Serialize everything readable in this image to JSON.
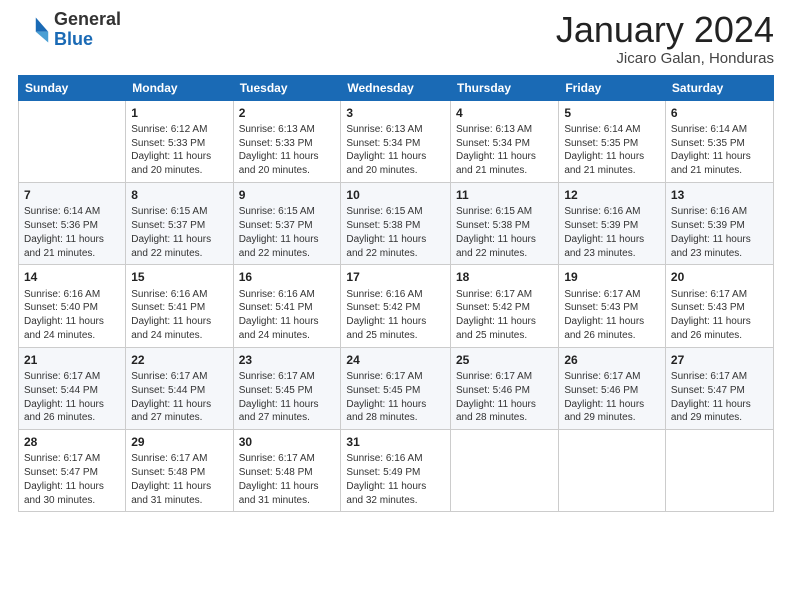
{
  "header": {
    "logo_general": "General",
    "logo_blue": "Blue",
    "month_title": "January 2024",
    "subtitle": "Jicaro Galan, Honduras"
  },
  "days_of_week": [
    "Sunday",
    "Monday",
    "Tuesday",
    "Wednesday",
    "Thursday",
    "Friday",
    "Saturday"
  ],
  "weeks": [
    [
      {
        "day": "",
        "text": ""
      },
      {
        "day": "1",
        "text": "Sunrise: 6:12 AM\nSunset: 5:33 PM\nDaylight: 11 hours\nand 20 minutes."
      },
      {
        "day": "2",
        "text": "Sunrise: 6:13 AM\nSunset: 5:33 PM\nDaylight: 11 hours\nand 20 minutes."
      },
      {
        "day": "3",
        "text": "Sunrise: 6:13 AM\nSunset: 5:34 PM\nDaylight: 11 hours\nand 20 minutes."
      },
      {
        "day": "4",
        "text": "Sunrise: 6:13 AM\nSunset: 5:34 PM\nDaylight: 11 hours\nand 21 minutes."
      },
      {
        "day": "5",
        "text": "Sunrise: 6:14 AM\nSunset: 5:35 PM\nDaylight: 11 hours\nand 21 minutes."
      },
      {
        "day": "6",
        "text": "Sunrise: 6:14 AM\nSunset: 5:35 PM\nDaylight: 11 hours\nand 21 minutes."
      }
    ],
    [
      {
        "day": "7",
        "text": "Sunrise: 6:14 AM\nSunset: 5:36 PM\nDaylight: 11 hours\nand 21 minutes."
      },
      {
        "day": "8",
        "text": "Sunrise: 6:15 AM\nSunset: 5:37 PM\nDaylight: 11 hours\nand 22 minutes."
      },
      {
        "day": "9",
        "text": "Sunrise: 6:15 AM\nSunset: 5:37 PM\nDaylight: 11 hours\nand 22 minutes."
      },
      {
        "day": "10",
        "text": "Sunrise: 6:15 AM\nSunset: 5:38 PM\nDaylight: 11 hours\nand 22 minutes."
      },
      {
        "day": "11",
        "text": "Sunrise: 6:15 AM\nSunset: 5:38 PM\nDaylight: 11 hours\nand 22 minutes."
      },
      {
        "day": "12",
        "text": "Sunrise: 6:16 AM\nSunset: 5:39 PM\nDaylight: 11 hours\nand 23 minutes."
      },
      {
        "day": "13",
        "text": "Sunrise: 6:16 AM\nSunset: 5:39 PM\nDaylight: 11 hours\nand 23 minutes."
      }
    ],
    [
      {
        "day": "14",
        "text": "Sunrise: 6:16 AM\nSunset: 5:40 PM\nDaylight: 11 hours\nand 24 minutes."
      },
      {
        "day": "15",
        "text": "Sunrise: 6:16 AM\nSunset: 5:41 PM\nDaylight: 11 hours\nand 24 minutes."
      },
      {
        "day": "16",
        "text": "Sunrise: 6:16 AM\nSunset: 5:41 PM\nDaylight: 11 hours\nand 24 minutes."
      },
      {
        "day": "17",
        "text": "Sunrise: 6:16 AM\nSunset: 5:42 PM\nDaylight: 11 hours\nand 25 minutes."
      },
      {
        "day": "18",
        "text": "Sunrise: 6:17 AM\nSunset: 5:42 PM\nDaylight: 11 hours\nand 25 minutes."
      },
      {
        "day": "19",
        "text": "Sunrise: 6:17 AM\nSunset: 5:43 PM\nDaylight: 11 hours\nand 26 minutes."
      },
      {
        "day": "20",
        "text": "Sunrise: 6:17 AM\nSunset: 5:43 PM\nDaylight: 11 hours\nand 26 minutes."
      }
    ],
    [
      {
        "day": "21",
        "text": "Sunrise: 6:17 AM\nSunset: 5:44 PM\nDaylight: 11 hours\nand 26 minutes."
      },
      {
        "day": "22",
        "text": "Sunrise: 6:17 AM\nSunset: 5:44 PM\nDaylight: 11 hours\nand 27 minutes."
      },
      {
        "day": "23",
        "text": "Sunrise: 6:17 AM\nSunset: 5:45 PM\nDaylight: 11 hours\nand 27 minutes."
      },
      {
        "day": "24",
        "text": "Sunrise: 6:17 AM\nSunset: 5:45 PM\nDaylight: 11 hours\nand 28 minutes."
      },
      {
        "day": "25",
        "text": "Sunrise: 6:17 AM\nSunset: 5:46 PM\nDaylight: 11 hours\nand 28 minutes."
      },
      {
        "day": "26",
        "text": "Sunrise: 6:17 AM\nSunset: 5:46 PM\nDaylight: 11 hours\nand 29 minutes."
      },
      {
        "day": "27",
        "text": "Sunrise: 6:17 AM\nSunset: 5:47 PM\nDaylight: 11 hours\nand 29 minutes."
      }
    ],
    [
      {
        "day": "28",
        "text": "Sunrise: 6:17 AM\nSunset: 5:47 PM\nDaylight: 11 hours\nand 30 minutes."
      },
      {
        "day": "29",
        "text": "Sunrise: 6:17 AM\nSunset: 5:48 PM\nDaylight: 11 hours\nand 31 minutes."
      },
      {
        "day": "30",
        "text": "Sunrise: 6:17 AM\nSunset: 5:48 PM\nDaylight: 11 hours\nand 31 minutes."
      },
      {
        "day": "31",
        "text": "Sunrise: 6:16 AM\nSunset: 5:49 PM\nDaylight: 11 hours\nand 32 minutes."
      },
      {
        "day": "",
        "text": ""
      },
      {
        "day": "",
        "text": ""
      },
      {
        "day": "",
        "text": ""
      }
    ]
  ]
}
